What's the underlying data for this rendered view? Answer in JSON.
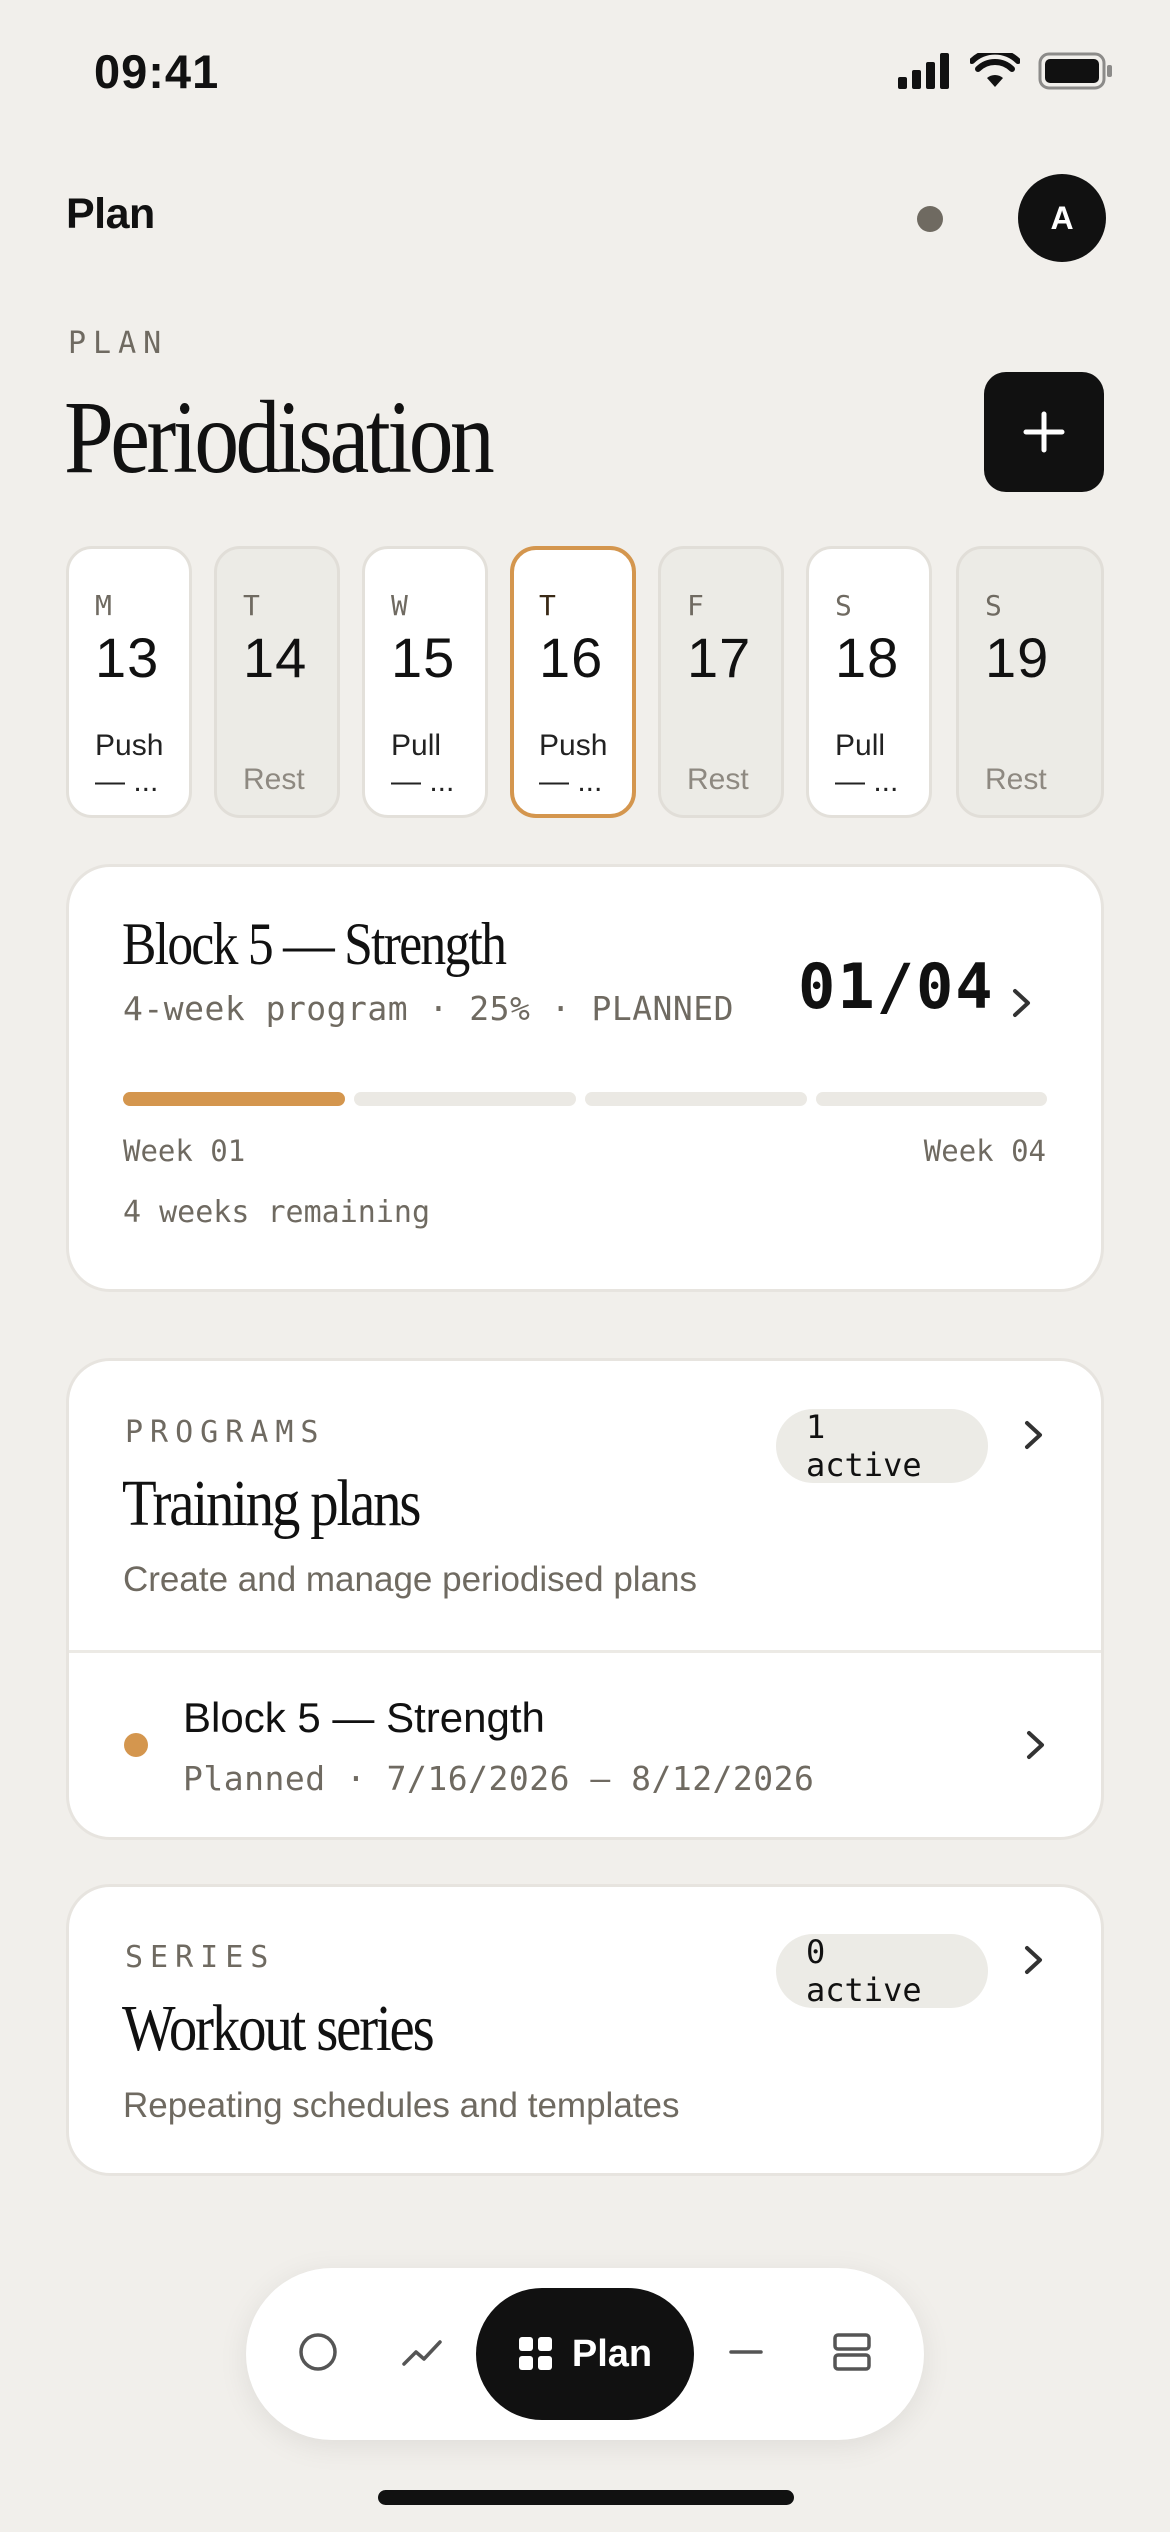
{
  "status": {
    "time": "09:41"
  },
  "header": {
    "app_title": "Plan",
    "avatar_initial": "A"
  },
  "page": {
    "eyebrow": "PLAN",
    "title": "Periodisation"
  },
  "days": [
    {
      "letter": "M",
      "num": "13",
      "type": "Push",
      "sub": "— ...",
      "rest": false
    },
    {
      "letter": "T",
      "num": "14",
      "type": "Rest",
      "sub": "",
      "rest": true
    },
    {
      "letter": "W",
      "num": "15",
      "type": "Pull",
      "sub": "— ...",
      "rest": false
    },
    {
      "letter": "T",
      "num": "16",
      "type": "Push",
      "sub": "— ...",
      "rest": false,
      "active": true
    },
    {
      "letter": "F",
      "num": "17",
      "type": "Rest",
      "sub": "",
      "rest": true
    },
    {
      "letter": "S",
      "num": "18",
      "type": "Pull",
      "sub": "— ...",
      "rest": false
    },
    {
      "letter": "S",
      "num": "19",
      "type": "Rest",
      "sub": "",
      "rest": true
    }
  ],
  "block": {
    "title": "Block 5 — Strength",
    "subtitle": "4-week program · 25% · PLANNED",
    "count": "01/04",
    "progress": 0.25,
    "week_start": "Week 01",
    "week_end": "Week 04",
    "remaining": "4 weeks remaining"
  },
  "programs": {
    "eyebrow": "PROGRAMS",
    "title": "Training plans",
    "description": "Create and manage periodised plans",
    "badge": "1 active",
    "item": {
      "name": "Block 5 — Strength",
      "meta": "Planned · 7/16/2026 – 8/12/2026"
    }
  },
  "series": {
    "eyebrow": "SERIES",
    "title": "Workout series",
    "description": "Repeating schedules and templates",
    "badge": "0 active"
  },
  "tabbar": {
    "active_label": "Plan"
  },
  "colors": {
    "accent": "#d4964e",
    "background": "#f1efeb",
    "ink": "#111111"
  }
}
